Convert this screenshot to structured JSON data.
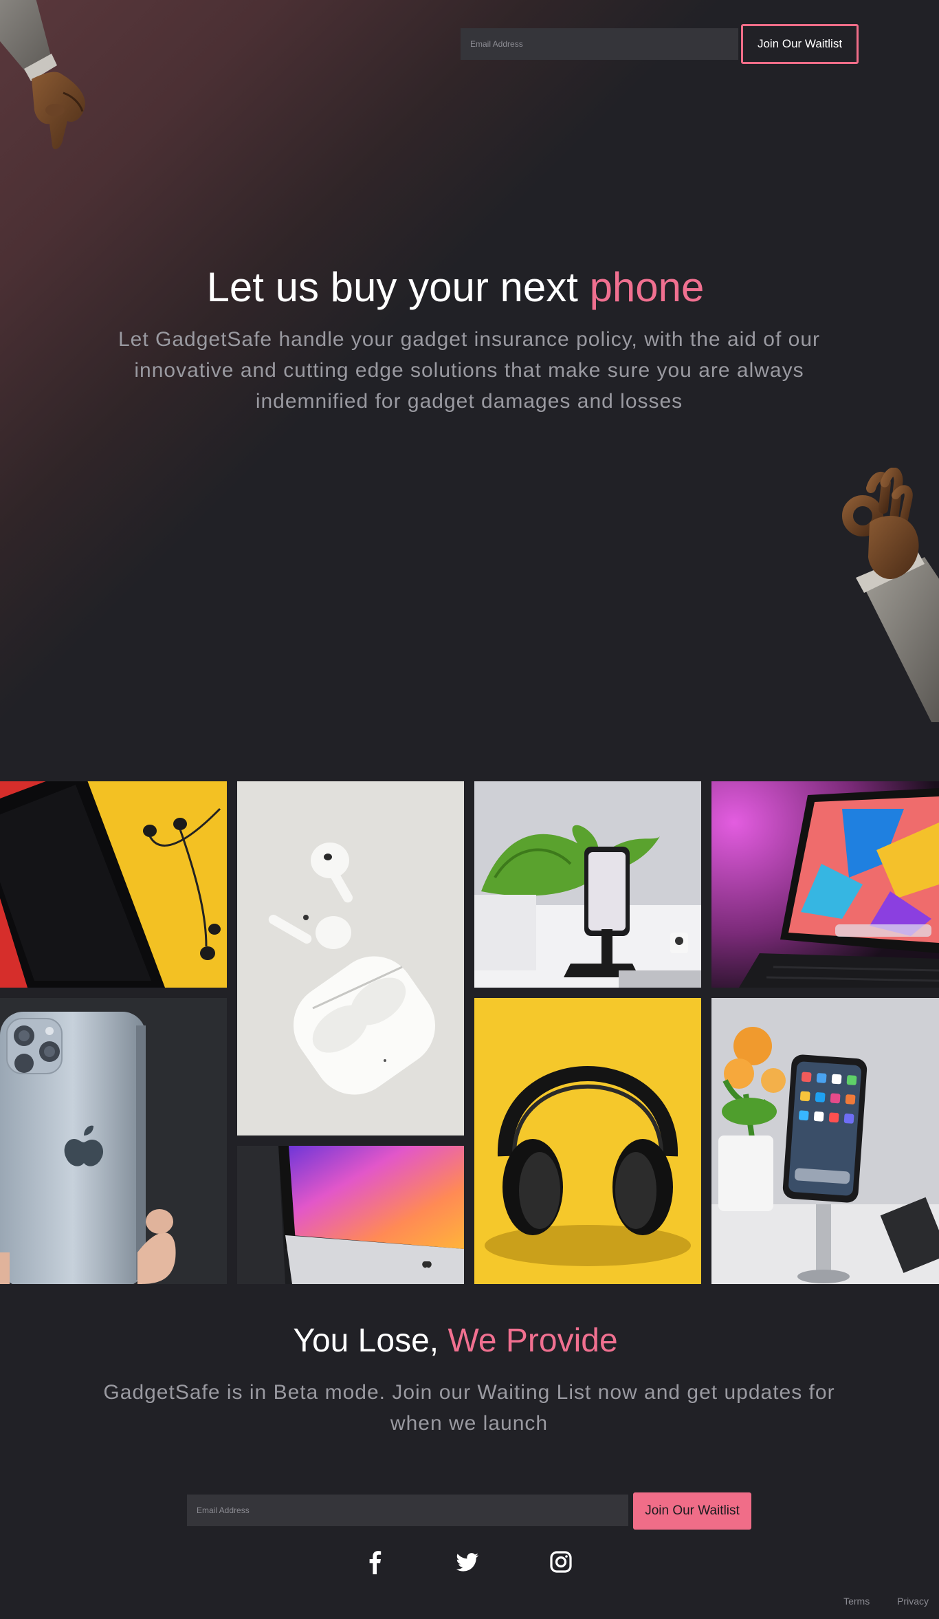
{
  "header": {
    "email_placeholder": "Email Address",
    "cta_label": "Join Our Waitlist"
  },
  "hero": {
    "title_main": "Let us buy your next ",
    "title_accent": "phone",
    "subtitle": "Let GadgetSafe handle your gadget insurance policy, with the aid of our innovative and cutting edge solutions that make sure you are always indemnified for gadget damages and losses"
  },
  "gallery": {
    "tiles": [
      "phone-earphones-photo",
      "airpods-photo",
      "iphone-stand-photo",
      "ipad-photo",
      "iphone-back-photo",
      "imac-photo",
      "headphones-photo",
      "iphone-flower-photo"
    ]
  },
  "section": {
    "title_main": "You Lose, ",
    "title_accent": "We Provide",
    "subtitle": "GadgetSafe is in Beta mode. Join our Waiting List now and get updates for when we launch"
  },
  "signup": {
    "email_placeholder": "Email Address",
    "cta_label": "Join Our Waitlist"
  },
  "socials": [
    "facebook-icon",
    "twitter-icon",
    "instagram-icon"
  ],
  "footer": {
    "terms": "Terms",
    "privacy": "Privacy"
  },
  "colors": {
    "background": "#212126",
    "accent": "#f06d88",
    "muted_text": "#9a9aa1",
    "input_bg": "#35353a"
  }
}
